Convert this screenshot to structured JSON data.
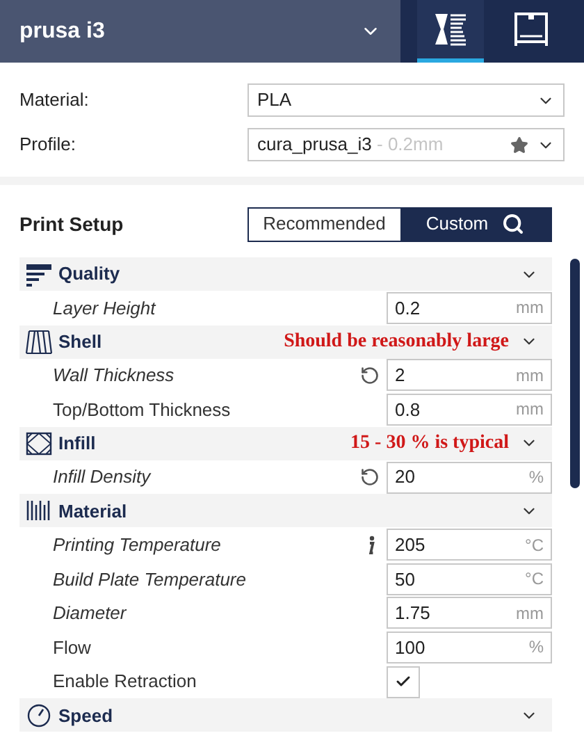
{
  "printer": {
    "name": "prusa i3"
  },
  "header_tabs": [
    {
      "selected": true
    },
    {
      "selected": false
    }
  ],
  "selectors": [
    {
      "label": "Material:",
      "value": "PLA",
      "favorite": false
    },
    {
      "label": "Profile:",
      "value": "cura_prusa_i3",
      "hint": "- 0.2mm",
      "favorite": true
    }
  ],
  "print_setup": {
    "title": "Print Setup",
    "modes": [
      {
        "label": "Recommended",
        "selected": false
      },
      {
        "label": "Custom",
        "selected": true
      }
    ]
  },
  "categories": [
    {
      "title": "Quality",
      "settings": [
        {
          "kind": "field",
          "label": "Layer Height",
          "italic": true,
          "value": "0.2",
          "unit": "mm"
        }
      ]
    },
    {
      "title": "Shell",
      "note": "Should be reasonably large",
      "settings": [
        {
          "kind": "field",
          "label": "Wall Thickness",
          "italic": true,
          "reset": true,
          "value": "2",
          "unit": "mm"
        },
        {
          "kind": "field",
          "label": "Top/Bottom Thickness",
          "italic": false,
          "value": "0.8",
          "unit": "mm"
        }
      ]
    },
    {
      "title": "Infill",
      "note": "15 - 30 % is typical",
      "settings": [
        {
          "kind": "field",
          "label": "Infill Density",
          "italic": true,
          "reset": true,
          "value": "20",
          "unit": "%"
        }
      ]
    },
    {
      "title": "Material",
      "settings": [
        {
          "kind": "field",
          "label": "Printing Temperature",
          "italic": true,
          "info": true,
          "value": "205",
          "unit": "°C"
        },
        {
          "kind": "field",
          "label": "Build Plate Temperature",
          "italic": true,
          "value": "50",
          "unit": "°C"
        },
        {
          "kind": "field",
          "label": "Diameter",
          "italic": true,
          "value": "1.75",
          "unit": "mm"
        },
        {
          "kind": "field",
          "label": "Flow",
          "italic": false,
          "value": "100",
          "unit": "%"
        },
        {
          "kind": "checkbox",
          "label": "Enable Retraction",
          "italic": false,
          "checked": true
        }
      ]
    },
    {
      "title": "Speed"
    }
  ]
}
